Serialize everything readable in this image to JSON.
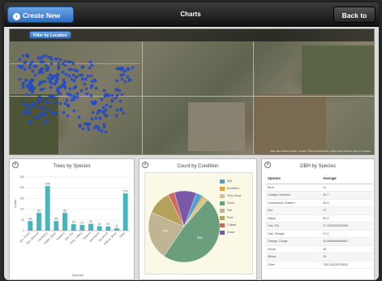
{
  "header": {
    "create_label": "Create New Chart",
    "title": "Charts",
    "back_label": "Back to Map",
    "chevron_glyph": "‹"
  },
  "map": {
    "filter_label": "Filter by Location",
    "credit": "Map data ©2012 Google, Imagery ©2012 DigitalGlobe, USDA Farm Service Agency, GeoEye"
  },
  "panels": {
    "close_glyph": "×",
    "species_title": "Trees by Species",
    "condition_title": "Count by Condition",
    "dbh_title": "DBH by Species"
  },
  "chart_data": [
    {
      "type": "bar",
      "title": "Trees by Species",
      "xlabel": "Species",
      "ylabel": "Count",
      "categories": [
        "Ash, Green",
        "Elm, Siberian",
        "Hackberry",
        "Maple, Silver",
        "Mulberry",
        "Oak, Bur",
        "Pear, Callery",
        "Redbud",
        "Sweetgum",
        "Sycamore",
        "Walnut, Black",
        "Other"
      ],
      "values": [
        45,
        83,
        208,
        45,
        83,
        30,
        27,
        32,
        21,
        20,
        11,
        174
      ],
      "data_labels": [
        "45",
        "83",
        "208",
        "45",
        "83",
        "30",
        "27",
        "32",
        "21",
        "20",
        "11",
        "174"
      ],
      "color": "#48b5bd"
    },
    {
      "type": "pie",
      "title": "Count by Condition",
      "slices": [
        {
          "label": "N/A",
          "value": 3,
          "color": "#4f9fd0"
        },
        {
          "label": "Excellent",
          "value": 1,
          "color": "#e6a23c"
        },
        {
          "label": "Very Good",
          "value": 2,
          "color": "#d4c48a"
        },
        {
          "label": "Good",
          "value": 48,
          "color": "#6b9e7d"
        },
        {
          "label": "Fair",
          "value": 22,
          "color": "#c0b592"
        },
        {
          "label": "Poor",
          "value": 11,
          "color": "#b4a25a"
        },
        {
          "label": "Critical",
          "value": 3,
          "color": "#d06a5c"
        },
        {
          "label": "Dead",
          "value": 10,
          "color": "#7b58a8"
        }
      ],
      "slice_labels": [
        "",
        "",
        "",
        "608",
        "209",
        "",
        "",
        ""
      ]
    }
  ],
  "dbh_table": {
    "headers": [
      "Species",
      "Average"
    ],
    "rows": [
      [
        "Birch",
        "41"
      ],
      [
        "Catalpa, Northern",
        "26.7"
      ],
      [
        "Cottonwood, Eastern",
        "36.3"
      ],
      [
        "Elm",
        "37"
      ],
      [
        "Maple",
        "30.3"
      ],
      [
        "Oak, Pin",
        "27.4333333344994"
      ],
      [
        "Oak, Shingle",
        "27.3"
      ],
      [
        "Orange, Osage",
        "35.6666666666667"
      ],
      [
        "Pecan",
        "36"
      ],
      [
        "Willow",
        "26"
      ],
      [
        "Other",
        "738.333228799819"
      ]
    ]
  }
}
